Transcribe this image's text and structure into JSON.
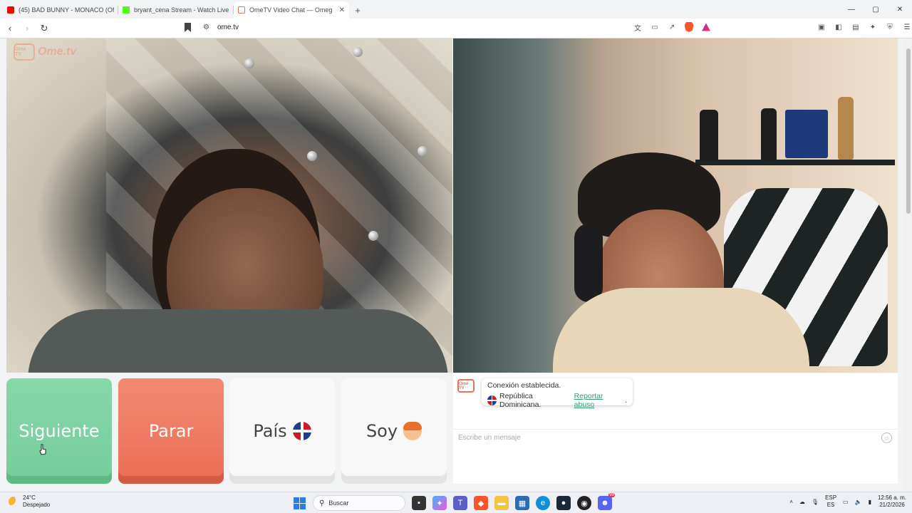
{
  "browser": {
    "tabs": [
      {
        "title": "(45) BAD BUNNY - MONACO (Officia",
        "favicon_color": "#ff0000",
        "active": false
      },
      {
        "title": "bryant_cena Stream - Watch Live",
        "favicon_color": "#53fc18",
        "active": false
      },
      {
        "title": "OmeTV Video Chat — Omeg",
        "favicon_color": "#e9735a",
        "active": true
      }
    ],
    "new_tab_glyph": "+",
    "url": "ome.tv",
    "window_controls": {
      "minimize": "—",
      "maximize": "▢",
      "close": "✕"
    }
  },
  "site": {
    "logo_badge": "Ome TV",
    "logo_text": "Ome.tv",
    "buttons": {
      "next": "Siguiente",
      "stop": "Parar",
      "country": "País",
      "gender": "Soy"
    },
    "chat": {
      "logo_badge": "Ome TV",
      "status": "Conexión establecida.",
      "country": "República Dominicana.",
      "report_link": "Reportar abuso",
      "report_suffix": ".",
      "input_placeholder": "Escribe un mensaje"
    }
  },
  "taskbar": {
    "weather_temp": "24°C",
    "weather_desc": "Despejado",
    "search_placeholder": "Buscar",
    "language": "ESP",
    "language_sub": "ES",
    "time": "12:56 a. m.",
    "date": "21/2/2026",
    "notification_badge": "99"
  },
  "colors": {
    "next_button": "#7cd3a0",
    "stop_button": "#ef7a61",
    "link": "#3a9b72",
    "brand": "#e9735a"
  }
}
